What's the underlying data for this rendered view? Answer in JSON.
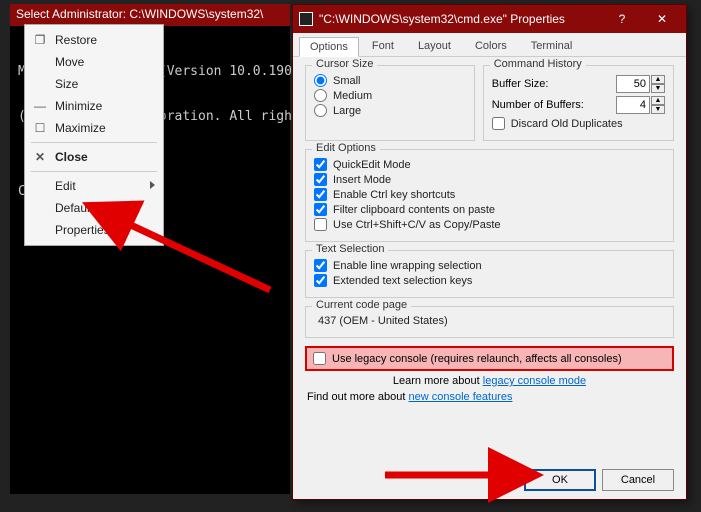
{
  "cmd": {
    "title": "Select Administrator: C:\\WINDOWS\\system32\\",
    "lines": [
      "Microsoft Windows [Version 10.0.190",
      "(c) Microsoft Corporation. All righ",
      "",
      "C:\\>"
    ]
  },
  "menu": {
    "restore": "Restore",
    "move": "Move",
    "size": "Size",
    "minimize": "Minimize",
    "maximize": "Maximize",
    "close": "Close",
    "edit": "Edit",
    "defaults": "Defaults",
    "properties": "Properties"
  },
  "props": {
    "title": "\"C:\\WINDOWS\\system32\\cmd.exe\" Properties",
    "tabs": {
      "options": "Options",
      "font": "Font",
      "layout": "Layout",
      "colors": "Colors",
      "terminal": "Terminal"
    },
    "cursor": {
      "legend": "Cursor Size",
      "small": "Small",
      "medium": "Medium",
      "large": "Large"
    },
    "history": {
      "legend": "Command History",
      "buffer_label": "Buffer Size:",
      "buffer_value": "50",
      "num_label": "Number of Buffers:",
      "num_value": "4",
      "discard": "Discard Old Duplicates"
    },
    "edit": {
      "legend": "Edit Options",
      "quickedit": "QuickEdit Mode",
      "insert": "Insert Mode",
      "ctrlkey": "Enable Ctrl key shortcuts",
      "filter": "Filter clipboard contents on paste",
      "ctrlshift": "Use Ctrl+Shift+C/V as Copy/Paste"
    },
    "textsel": {
      "legend": "Text Selection",
      "wrap": "Enable line wrapping selection",
      "extended": "Extended text selection keys"
    },
    "codepage": {
      "legend": "Current code page",
      "value": "437   (OEM - United States)"
    },
    "legacy": {
      "label": "Use legacy console (requires relaunch, affects all consoles)",
      "learn_prefix": "Learn more about ",
      "learn_link": "legacy console mode"
    },
    "find": {
      "prefix": "Find out more about ",
      "link": "new console features"
    },
    "buttons": {
      "ok": "OK",
      "cancel": "Cancel"
    }
  }
}
